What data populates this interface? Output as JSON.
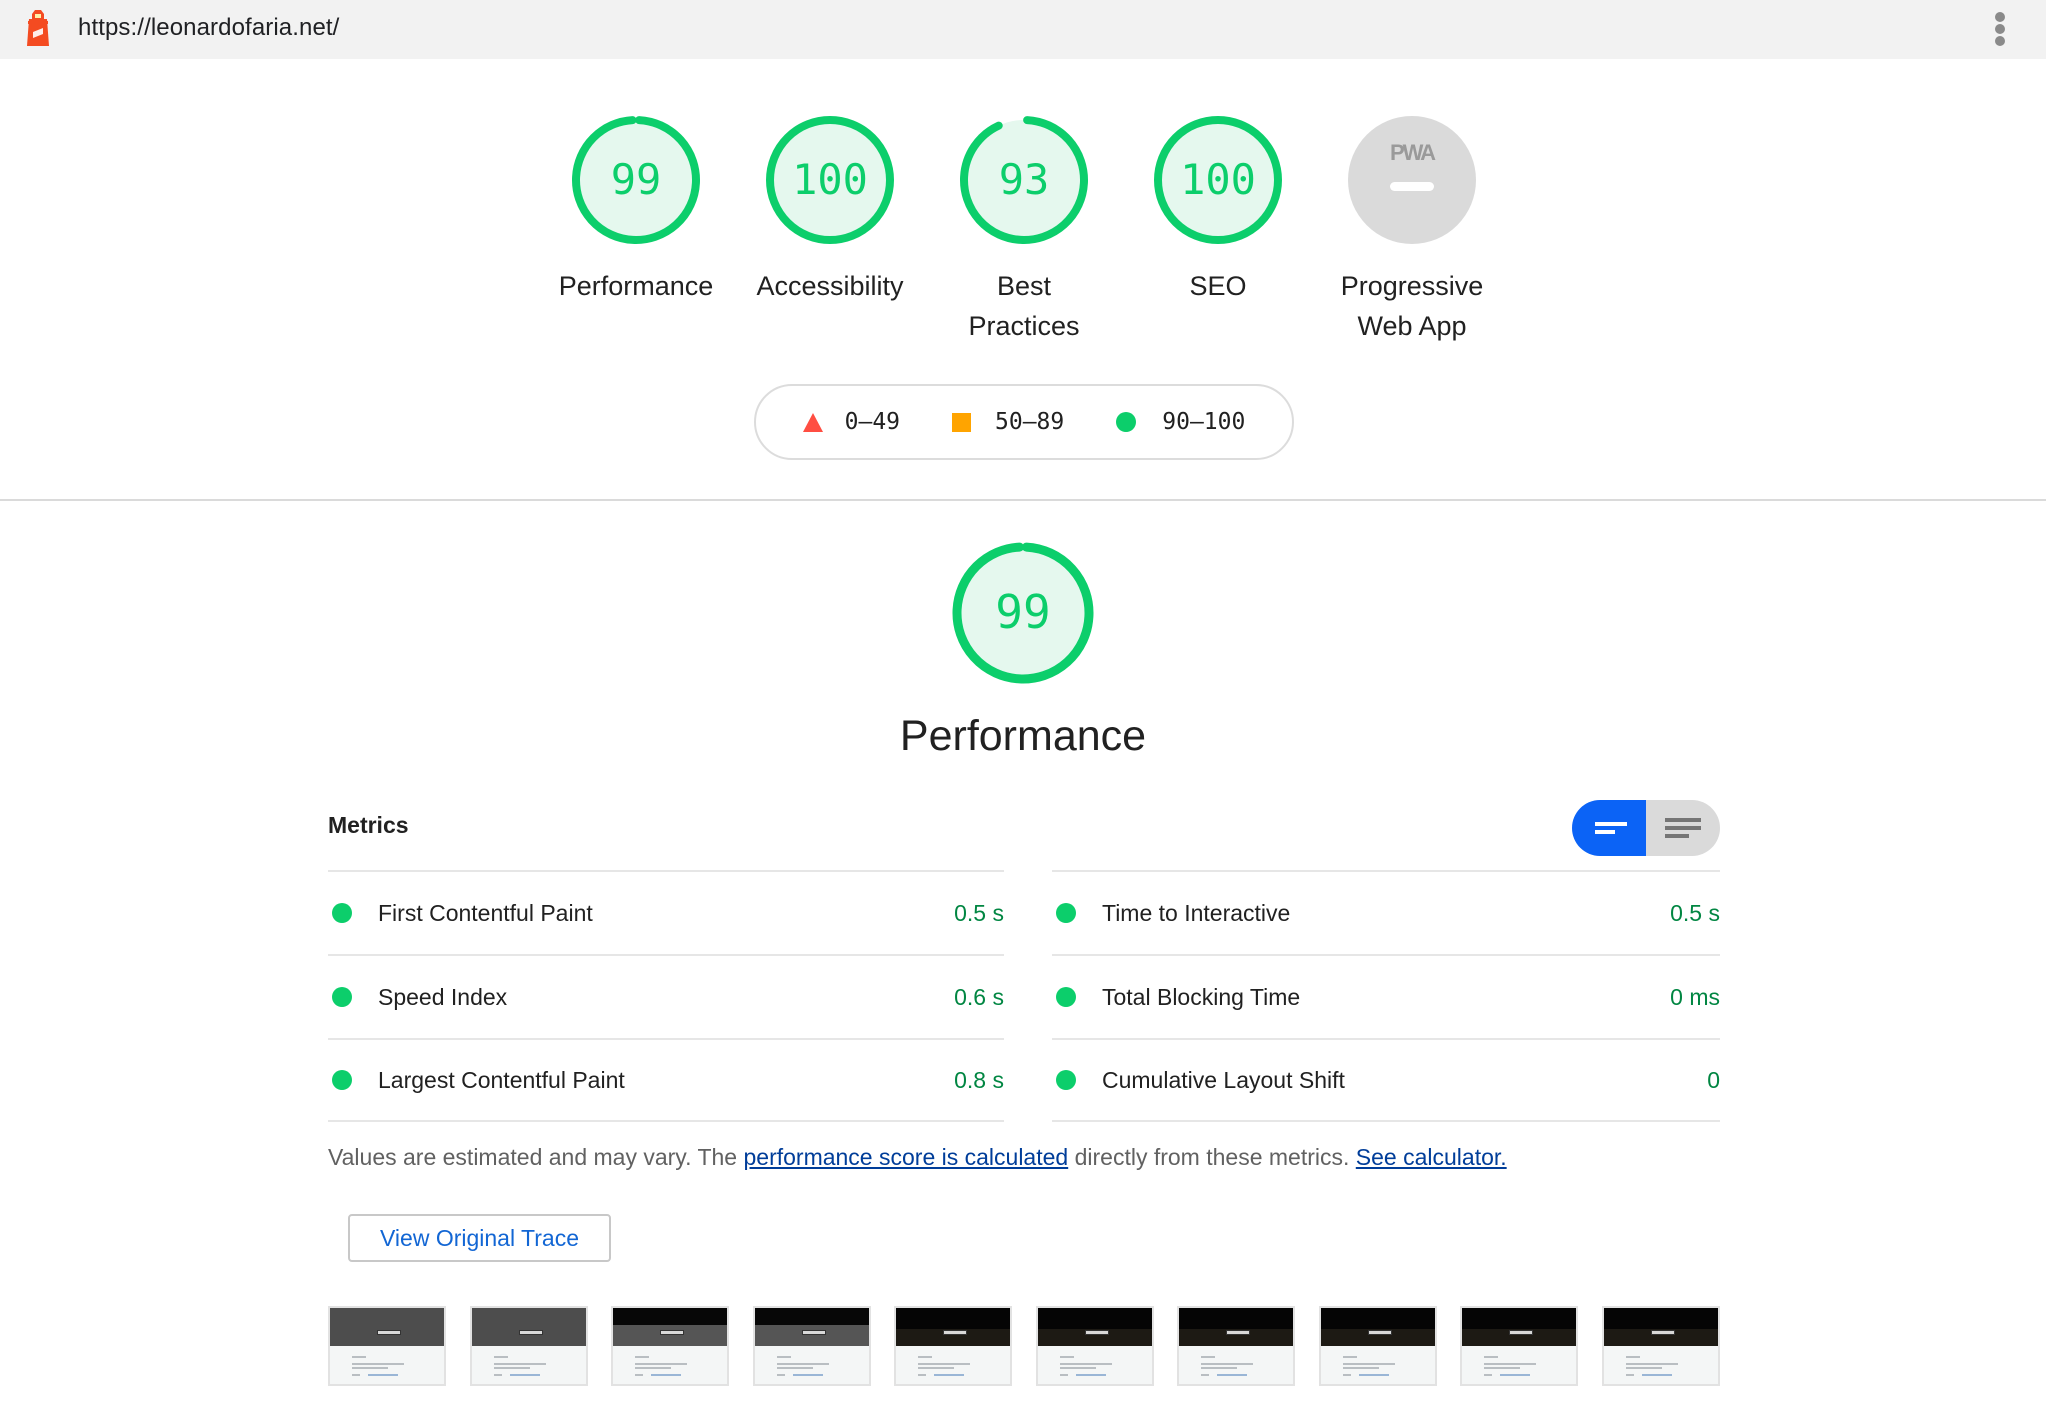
{
  "topbar": {
    "url": "https://leonardofaria.net/",
    "logo_icon": "lighthouse-icon",
    "menu_icon": "more-vert-icon"
  },
  "summary": {
    "categories": [
      {
        "label": "Performance",
        "score": 99,
        "rating": "pass"
      },
      {
        "label": "Accessibility",
        "score": 100,
        "rating": "pass"
      },
      {
        "label": "Best Practices",
        "score": 93,
        "rating": "pass"
      },
      {
        "label": "SEO",
        "score": 100,
        "rating": "pass"
      },
      {
        "label": "Progressive Web App",
        "score": null,
        "badge": "PWA",
        "rating": "na"
      }
    ]
  },
  "legend": {
    "fail": "0–49",
    "average": "50–89",
    "pass": "90–100"
  },
  "colors": {
    "pass": "#0cce6b",
    "pass_fill": "#e5f8ee",
    "pass_text": "#018642",
    "average": "#ffa400",
    "fail": "#ff4e42",
    "na": "#dadada",
    "accent": "#0b63f6",
    "link": "#003d99"
  },
  "performance": {
    "score": 99,
    "title": "Performance",
    "metrics_heading": "Metrics",
    "view_toggle": {
      "selected": "summary",
      "options": [
        "summary",
        "expanded"
      ]
    },
    "metrics_left": [
      {
        "name": "First Contentful Paint",
        "value": "0.5 s"
      },
      {
        "name": "Speed Index",
        "value": "0.6 s"
      },
      {
        "name": "Largest Contentful Paint",
        "value": "0.8 s"
      }
    ],
    "metrics_right": [
      {
        "name": "Time to Interactive",
        "value": "0.5 s"
      },
      {
        "name": "Total Blocking Time",
        "value": "0 ms"
      },
      {
        "name": "Cumulative Layout Shift",
        "value": "0"
      }
    ],
    "note_prefix": "Values are estimated and may vary. The ",
    "note_link1": "performance score is calculated",
    "note_middle": " directly from these metrics. ",
    "note_link2": "See calculator.",
    "trace_button": "View Original Trace",
    "filmstrip_frames": 10
  }
}
